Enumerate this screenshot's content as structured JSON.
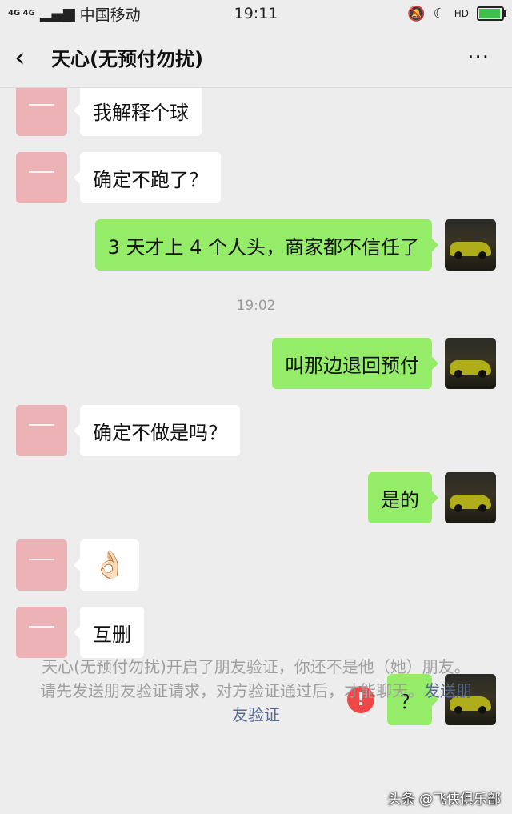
{
  "status_bar": {
    "network": "4G 4G",
    "carrier": "中国移动",
    "time": "19:11",
    "hd_label": "HD"
  },
  "header": {
    "back_icon": "chevron-left-icon",
    "title": "天心(无预付勿扰)",
    "more_icon": "more-icon",
    "more_glyph": "···"
  },
  "messages": [
    {
      "side": "in",
      "text": "我解释个球"
    },
    {
      "side": "in",
      "text": "确定不跑了？"
    },
    {
      "side": "out",
      "text": "3 天才上 4 个人头，商家都不信任了"
    },
    {
      "side": "out",
      "text": "叫那边退回预付"
    },
    {
      "side": "in",
      "text": "确定不做是吗？"
    },
    {
      "side": "out",
      "text": "是的"
    },
    {
      "side": "in",
      "text": "👌🏻"
    },
    {
      "side": "in",
      "text": "互删"
    },
    {
      "side": "out",
      "text": "？",
      "failed": true
    }
  ],
  "timestamp": "19:02",
  "error_icon_glyph": "!",
  "notice": {
    "text": "天心(无预付勿扰)开启了朋友验证，你还不是他（她）朋友。请先发送朋友验证请求，对方验证通过后，才能聊天。",
    "link": "发送朋友验证"
  },
  "watermark": "头条 @飞侠俱乐部",
  "colors": {
    "outgoing_bubble": "#95ec69",
    "incoming_bubble": "#ffffff",
    "background": "#ededed",
    "error": "#f04848",
    "link": "#576b95"
  }
}
